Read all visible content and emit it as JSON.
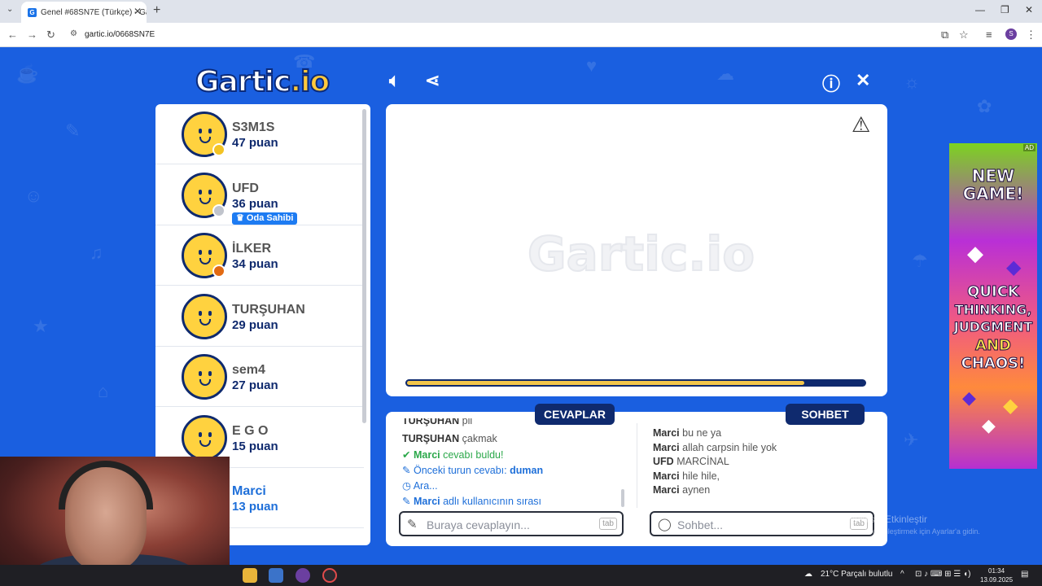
{
  "browser": {
    "tab_title": "Genel #68SN7E (Türkçe) - Gartic.io",
    "url": "gartic.io/0668SN7E",
    "profile_initial": "S"
  },
  "game": {
    "logo_main": "Gartic",
    "logo_accent": ".io",
    "watermark": "Gartic.io",
    "timer_progress": 0.87,
    "players": [
      {
        "name": "S3M1S",
        "score": "47 puan",
        "dot": "#f3c323",
        "name_color": "#555555"
      },
      {
        "name": "UFD",
        "score": "36 puan",
        "dot": "#c0c4cc",
        "badge": "Oda Sahibi",
        "name_color": "#555555"
      },
      {
        "name": "İLKER",
        "score": "34 puan",
        "dot": "#e26a12",
        "name_color": "#555555"
      },
      {
        "name": "TURŞUHAN",
        "score": "29 puan",
        "dot": "",
        "name_color": "#555555"
      },
      {
        "name": "sem4",
        "score": "27 puan",
        "dot": "",
        "name_color": "#555555"
      },
      {
        "name": "E G O",
        "score": "15 puan",
        "dot": "",
        "name_color": "#555555"
      },
      {
        "name": "Marci",
        "score": "13 puan",
        "dot": "",
        "name_color": "#1e6fd9"
      }
    ],
    "answers_tab": "CEVAPLAR",
    "chat_tab": "SOHBET",
    "answers": [
      {
        "user": "TURŞUHAN",
        "text": "pii"
      },
      {
        "user": "TURŞUHAN",
        "text": "çakmak"
      },
      {
        "icon": "✔",
        "user": "Marci",
        "text": "cevabı buldu!",
        "kind": "ok"
      },
      {
        "icon": "✎",
        "user": "",
        "text": "Önceki turun cevabı:",
        "extra": "duman",
        "kind": "sys"
      },
      {
        "icon": "◷",
        "user": "",
        "text": "Ara...",
        "kind": "sys"
      },
      {
        "icon": "✎",
        "user": "Marci",
        "text": "adlı kullanıcının sırası",
        "kind": "sys"
      }
    ],
    "chat": [
      {
        "user": "Marci",
        "text": "bu ne ya"
      },
      {
        "user": "Marci",
        "text": "allah carpsin hile yok"
      },
      {
        "user": "UFD",
        "text": "MARCİNAL"
      },
      {
        "user": "Marci",
        "text": "hile hile,"
      },
      {
        "user": "Marci",
        "text": "aynen"
      }
    ],
    "answer_placeholder": "Buraya cevaplayın...",
    "chat_placeholder": "Sohbet...",
    "tab_key": "tab"
  },
  "ad": {
    "tag": "AD",
    "line1": "NEW",
    "line2": "GAME!",
    "line3": "QUICK",
    "line4": "THINKING,",
    "line5": "JUDGMENT",
    "line6": "AND",
    "line7": "CHAOS!"
  },
  "windows": {
    "activate_title": "Windows'u Etkinleştir",
    "activate_sub": "Windows'u etkinleştirmek için Ayarlar'a gidin.",
    "weather": "21°C  Parçalı bulutlu",
    "time": "01:34",
    "date": "13.09.2025"
  }
}
